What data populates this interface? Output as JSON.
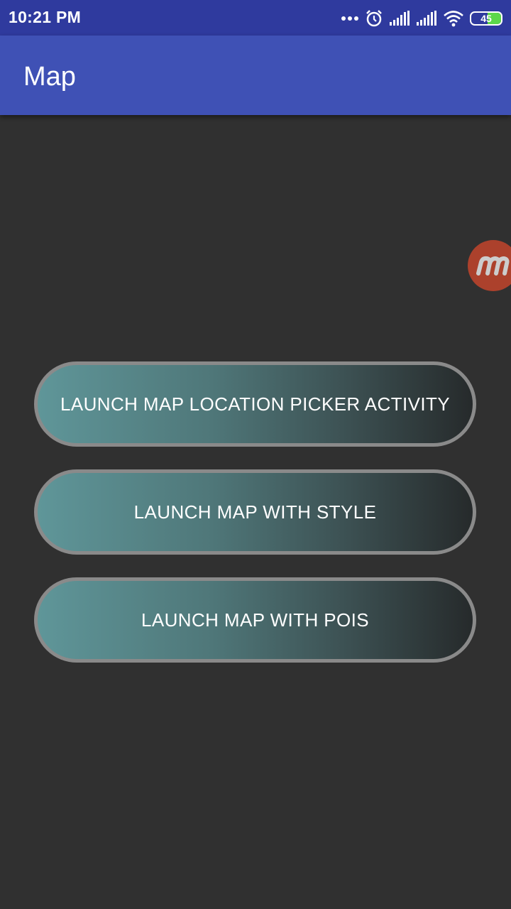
{
  "status_bar": {
    "time": "10:21 PM",
    "battery_level": "45",
    "battery_fraction": 0.45,
    "icons": [
      "more-dots-icon",
      "alarm-icon",
      "signal-icon",
      "signal-icon",
      "wifi-icon",
      "battery-icon"
    ]
  },
  "app_bar": {
    "title": "Map"
  },
  "buttons": {
    "location_picker": "LAUNCH MAP LOCATION PICKER ACTIVITY",
    "with_style": "LAUNCH MAP WITH STYLE",
    "with_pois": "LAUNCH MAP WITH POIS"
  },
  "colors": {
    "status_bar": "#2f3a9e",
    "app_bar": "#3f51b5",
    "background": "#303030",
    "button_gradient_start": "#5f9699",
    "button_gradient_end": "#262a2b",
    "button_border": "#8a8a8a",
    "bubble": "#c2452c"
  }
}
